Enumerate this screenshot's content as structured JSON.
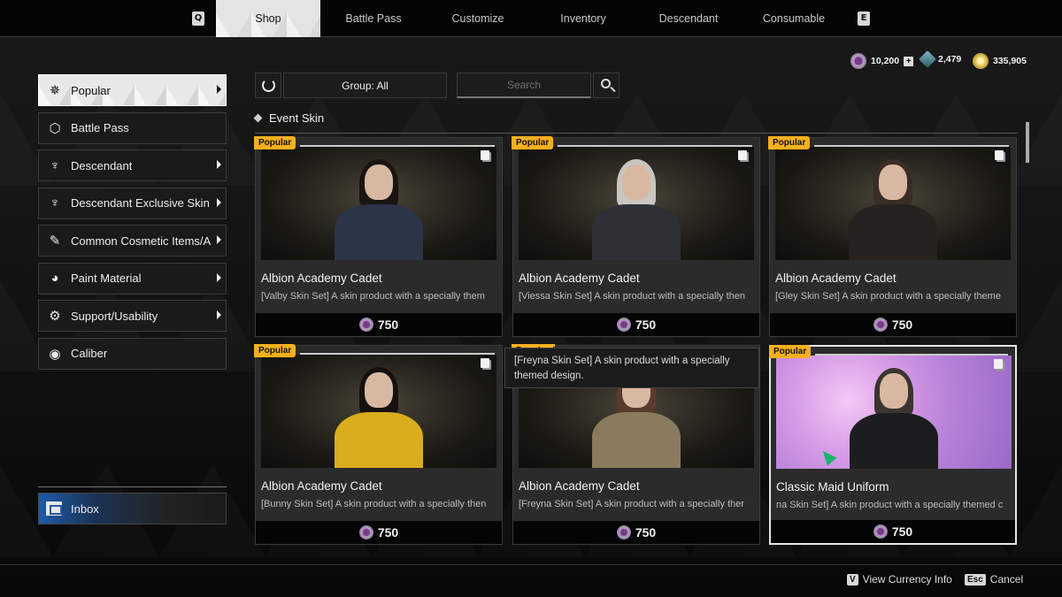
{
  "topnav": {
    "left_key": "Q",
    "right_key": "E",
    "tabs": [
      {
        "label": "Shop",
        "active": true
      },
      {
        "label": "Battle Pass",
        "active": false
      },
      {
        "label": "Customize",
        "active": false
      },
      {
        "label": "Inventory",
        "active": false
      },
      {
        "label": "Descendant",
        "active": false
      },
      {
        "label": "Consumable",
        "active": false
      }
    ]
  },
  "currencies": [
    {
      "name": "caliber",
      "value": "10,200",
      "icon": "caliber-coin-icon",
      "has_add": true
    },
    {
      "name": "crystal",
      "value": "2,479",
      "icon": "crystal-icon",
      "has_add": false
    },
    {
      "name": "gold",
      "value": "335,905",
      "icon": "gold-coin-icon",
      "has_add": false
    }
  ],
  "sidebar": {
    "items": [
      {
        "label": "Popular",
        "icon": "stars-icon",
        "glyph": "✵",
        "has_arrow": true,
        "active": true
      },
      {
        "label": "Battle Pass",
        "icon": "hexagon-icon",
        "glyph": "⬡",
        "has_arrow": false,
        "active": false
      },
      {
        "label": "Descendant",
        "icon": "descendant-emblem-icon",
        "glyph": "♆",
        "has_arrow": true,
        "active": false
      },
      {
        "label": "Descendant Exclusive Skin",
        "icon": "descendant-exclusive-icon",
        "glyph": "♆",
        "has_arrow": true,
        "active": false
      },
      {
        "label": "Common Cosmetic Items/A",
        "icon": "magic-wand-icon",
        "glyph": "✎",
        "has_arrow": true,
        "active": false
      },
      {
        "label": "Paint Material",
        "icon": "paint-bucket-icon",
        "glyph": "◕",
        "has_arrow": true,
        "active": false
      },
      {
        "label": "Support/Usability",
        "icon": "support-gear-icon",
        "glyph": "⚙",
        "has_arrow": true,
        "active": false
      },
      {
        "label": "Caliber",
        "icon": "caliber-icon",
        "glyph": "◉",
        "has_arrow": false,
        "active": false
      }
    ],
    "inbox_label": "Inbox"
  },
  "toolbar": {
    "group_label": "Group: All",
    "search_placeholder": "Search"
  },
  "section": {
    "title": "Event Skin"
  },
  "products": [
    {
      "badge": "Popular",
      "title": "Albion Academy Cadet",
      "desc": "[Valby Skin Set] A skin product with a specially them",
      "price": "750",
      "style": "tunnel",
      "hair": "#1b1512",
      "outfit": "#2c3448"
    },
    {
      "badge": "Popular",
      "title": "Albion Academy Cadet",
      "desc": "[Viessa Skin Set] A skin product with a specially then",
      "price": "750",
      "style": "tunnel",
      "hair": "#c9c6c0",
      "outfit": "#2f3036"
    },
    {
      "badge": "Popular",
      "title": "Albion Academy Cadet",
      "desc": "[Gley Skin Set] A skin product with a specially theme",
      "price": "750",
      "style": "tunnel",
      "hair": "#3a2d26",
      "outfit": "#25221f"
    },
    {
      "badge": "Popular",
      "title": "Albion Academy Cadet",
      "desc": "[Bunny Skin Set] A skin product with a specially then",
      "price": "750",
      "style": "tunnel",
      "hair": "#15110f",
      "outfit": "#d9ad1d"
    },
    {
      "badge": "Popular",
      "title": "Albion Academy Cadet",
      "desc": "[Freyna Skin Set] A skin product with a specially ther",
      "price": "750",
      "style": "tunnel",
      "hair": "#5a3a2c",
      "outfit": "#8a7a5e"
    },
    {
      "badge": "Popular",
      "title": "Classic Maid Uniform",
      "desc": "na Skin Set] A skin product with a specially themed c",
      "price": "750",
      "style": "pink",
      "hair": "#3b3430",
      "outfit": "#1d1d1f",
      "selected": true
    }
  ],
  "tooltip": {
    "text": "[Freyna Skin Set] A skin product with a specially themed design."
  },
  "footer": {
    "hints": [
      {
        "key": "V",
        "label": "View Currency Info"
      },
      {
        "key": "Esc",
        "label": "Cancel"
      }
    ]
  }
}
